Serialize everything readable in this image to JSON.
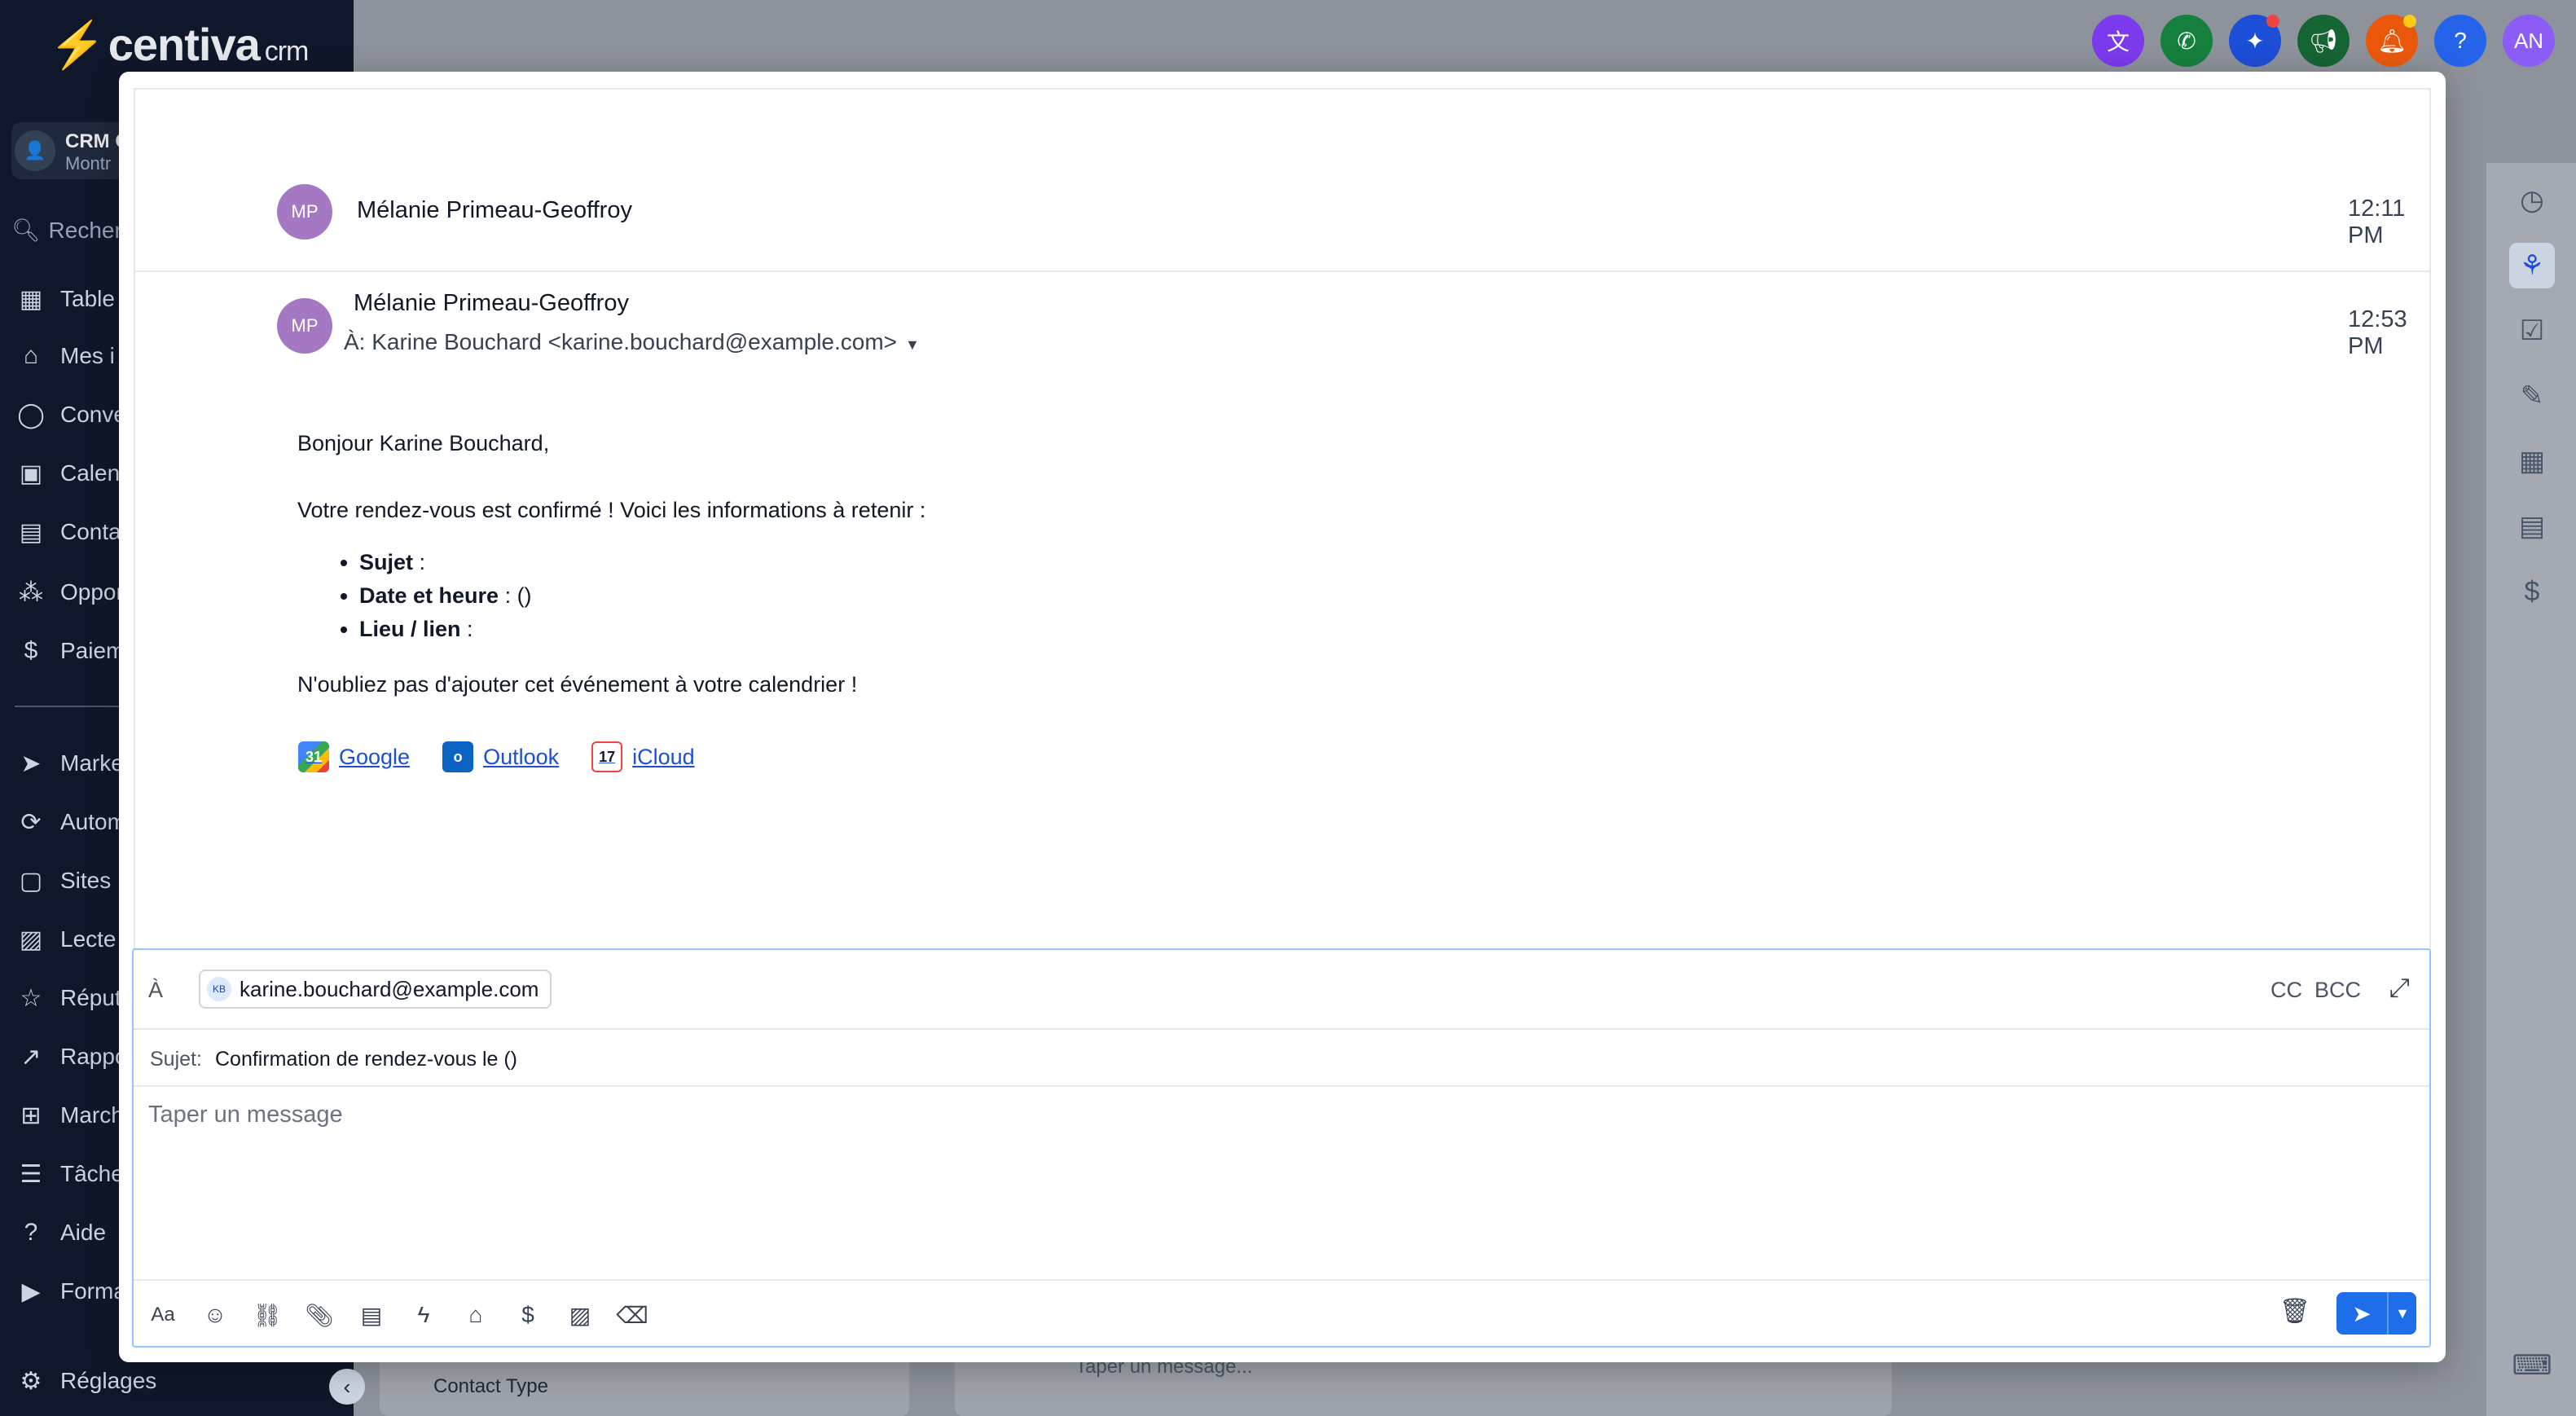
{
  "background": {
    "logo": {
      "brand": "centiva",
      "suffix": "crm"
    },
    "account": {
      "name": "CRM C",
      "location": "Montr",
      "initials": ""
    },
    "search_placeholder": "Recherc",
    "nav": [
      {
        "label": "Table",
        "icon": "dashboard-icon"
      },
      {
        "label": "Mes i",
        "icon": "home-icon"
      },
      {
        "label": "Conve",
        "icon": "chat-icon"
      },
      {
        "label": "Calen",
        "icon": "calendar-icon"
      },
      {
        "label": "Conta",
        "icon": "contacts-icon"
      },
      {
        "label": "Oppor",
        "icon": "opportunities-icon"
      },
      {
        "label": "Paiem",
        "icon": "payments-icon"
      },
      {
        "label": "Marke",
        "icon": "marketing-icon"
      },
      {
        "label": "Autom",
        "icon": "automation-icon"
      },
      {
        "label": "Sites",
        "icon": "sites-icon"
      },
      {
        "label": "Lecte",
        "icon": "media-icon"
      },
      {
        "label": "Réput",
        "icon": "star-icon"
      },
      {
        "label": "Rappo",
        "icon": "reports-icon"
      },
      {
        "label": "March",
        "icon": "marketplace-icon"
      },
      {
        "label": "Tâche",
        "icon": "tasks-icon"
      },
      {
        "label": "Aide",
        "icon": "help-icon"
      },
      {
        "label": "Forma",
        "icon": "video-icon"
      }
    ],
    "settings_label": "Réglages",
    "user_initials": "AN",
    "bottom_field_label": "Contact Type",
    "bottom_input_placeholder": "Taper un message..."
  },
  "thread": {
    "collapsed": {
      "initials": "MP",
      "sender": "Mélanie Primeau-Geoffroy",
      "time": "12:11 PM"
    },
    "expanded": {
      "initials": "MP",
      "sender": "Mélanie Primeau-Geoffroy",
      "to": "À: Karine Bouchard <karine.bouchard@example.com>",
      "time": "12:53 PM",
      "greeting": "Bonjour Karine Bouchard,",
      "intro": "Votre rendez-vous est confirmé ! Voici les informations à retenir :",
      "details": [
        {
          "label": "Sujet",
          "value": " :"
        },
        {
          "label": "Date et heure",
          "value": " : ()"
        },
        {
          "label": "Lieu / lien",
          "value": " :"
        }
      ],
      "reminder": "N'oubliez pas d'ajouter cet événement à votre calendrier !",
      "calendar_links": [
        {
          "label": "Google",
          "icon_text": "31"
        },
        {
          "label": "Outlook",
          "icon_text": "o"
        },
        {
          "label": "iCloud",
          "icon_text": "17"
        }
      ]
    }
  },
  "composer": {
    "to_label": "À",
    "recipient_initials": "KB",
    "recipient_email": "karine.bouchard@example.com",
    "cc_label": "CC",
    "bcc_label": "BCC",
    "subject_label": "Sujet:",
    "subject_value": "Confirmation de rendez-vous le  ()",
    "message_placeholder": "Taper un message"
  },
  "colors": {
    "avatar": "#a478c3",
    "send_button": "#1d6ee8",
    "link": "#1d4ed8"
  }
}
